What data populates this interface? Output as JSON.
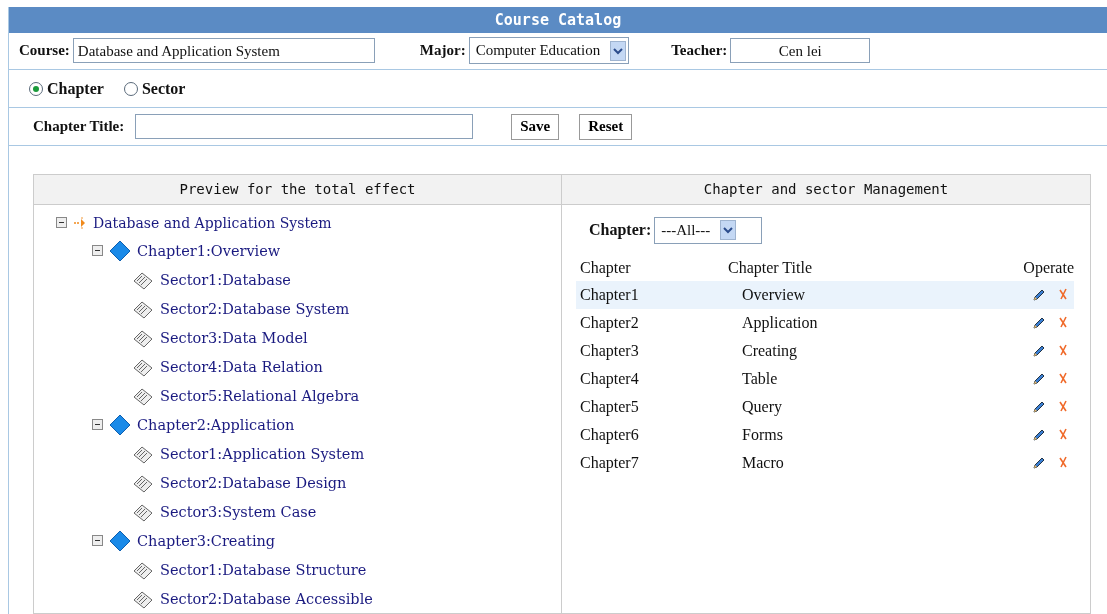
{
  "window": {
    "title": "Course Catalog"
  },
  "course": {
    "label": "Course:",
    "value": "Database and Application System"
  },
  "major": {
    "label": "Major:",
    "value": "Computer Education"
  },
  "teacher": {
    "label": "Teacher:",
    "value": "Cen lei"
  },
  "mode": [
    {
      "label": "Chapter",
      "selected": true
    },
    {
      "label": "Sector",
      "selected": false
    }
  ],
  "chapter_title": {
    "label": "Chapter Title:"
  },
  "buttons": [
    "Save",
    "Reset"
  ],
  "preview": {
    "heading": "Preview for the total effect",
    "tree": [
      {
        "kind": "root",
        "label": "Database and Application System",
        "expanded": true,
        "children": [
          {
            "kind": "chapter",
            "label": "Chapter1:Overview",
            "expanded": true,
            "children": [
              {
                "kind": "sector",
                "label": "Sector1:Database"
              },
              {
                "kind": "sector",
                "label": "Sector2:Database System"
              },
              {
                "kind": "sector",
                "label": "Sector3:Data Model"
              },
              {
                "kind": "sector",
                "label": "Sector4:Data Relation"
              },
              {
                "kind": "sector",
                "label": "Sector5:Relational Algebra"
              }
            ]
          },
          {
            "kind": "chapter",
            "label": "Chapter2:Application",
            "expanded": true,
            "children": [
              {
                "kind": "sector",
                "label": "Sector1:Application System"
              },
              {
                "kind": "sector",
                "label": "Sector2:Database Design"
              },
              {
                "kind": "sector",
                "label": "Sector3:System Case"
              }
            ]
          },
          {
            "kind": "chapter",
            "label": "Chapter3:Creating",
            "expanded": true,
            "children": [
              {
                "kind": "sector",
                "label": "Sector1:Database Structure"
              },
              {
                "kind": "sector",
                "label": "Sector2:Database Accessible"
              }
            ]
          }
        ]
      }
    ]
  },
  "management": {
    "heading": "Chapter and sector Management",
    "filter": {
      "label": "Chapter:",
      "value": "---All---"
    },
    "table": {
      "columns": [
        "Chapter",
        "Chapter Title",
        "Operate"
      ],
      "rows": [
        {
          "chapter": "Chapter1",
          "title": "Overview",
          "selected": true
        },
        {
          "chapter": "Chapter2",
          "title": "Application",
          "selected": false
        },
        {
          "chapter": "Chapter3",
          "title": "Creating",
          "selected": false
        },
        {
          "chapter": "Chapter4",
          "title": "Table",
          "selected": false
        },
        {
          "chapter": "Chapter5",
          "title": "Query",
          "selected": false
        },
        {
          "chapter": "Chapter6",
          "title": "Forms",
          "selected": false
        },
        {
          "chapter": "Chapter7",
          "title": "Macro",
          "selected": false
        }
      ]
    }
  }
}
